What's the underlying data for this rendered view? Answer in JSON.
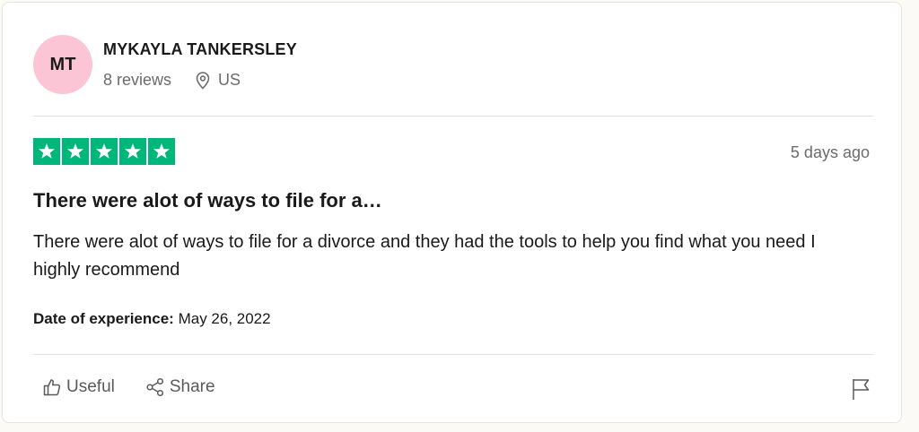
{
  "reviewer": {
    "initials": "MT",
    "name": "MYKAYLA TANKERSLEY",
    "reviews_count": "8 reviews",
    "location": "US",
    "avatar_color": "#fcc5d6"
  },
  "review": {
    "rating": 5,
    "rating_max": 5,
    "star_color": "#00b67a",
    "date_ago": "5 days ago",
    "title": "There were alot of ways to file for a…",
    "body": "There were alot of ways to file for a divorce and they had the tools to help you find what you need I highly recommend",
    "experience_label": "Date of experience:",
    "experience_date": "May 26, 2022"
  },
  "actions": {
    "useful_label": "Useful",
    "share_label": "Share",
    "icons": [
      "thumbs-up-icon",
      "share-icon",
      "flag-icon",
      "location-pin-icon",
      "star-icon"
    ]
  }
}
